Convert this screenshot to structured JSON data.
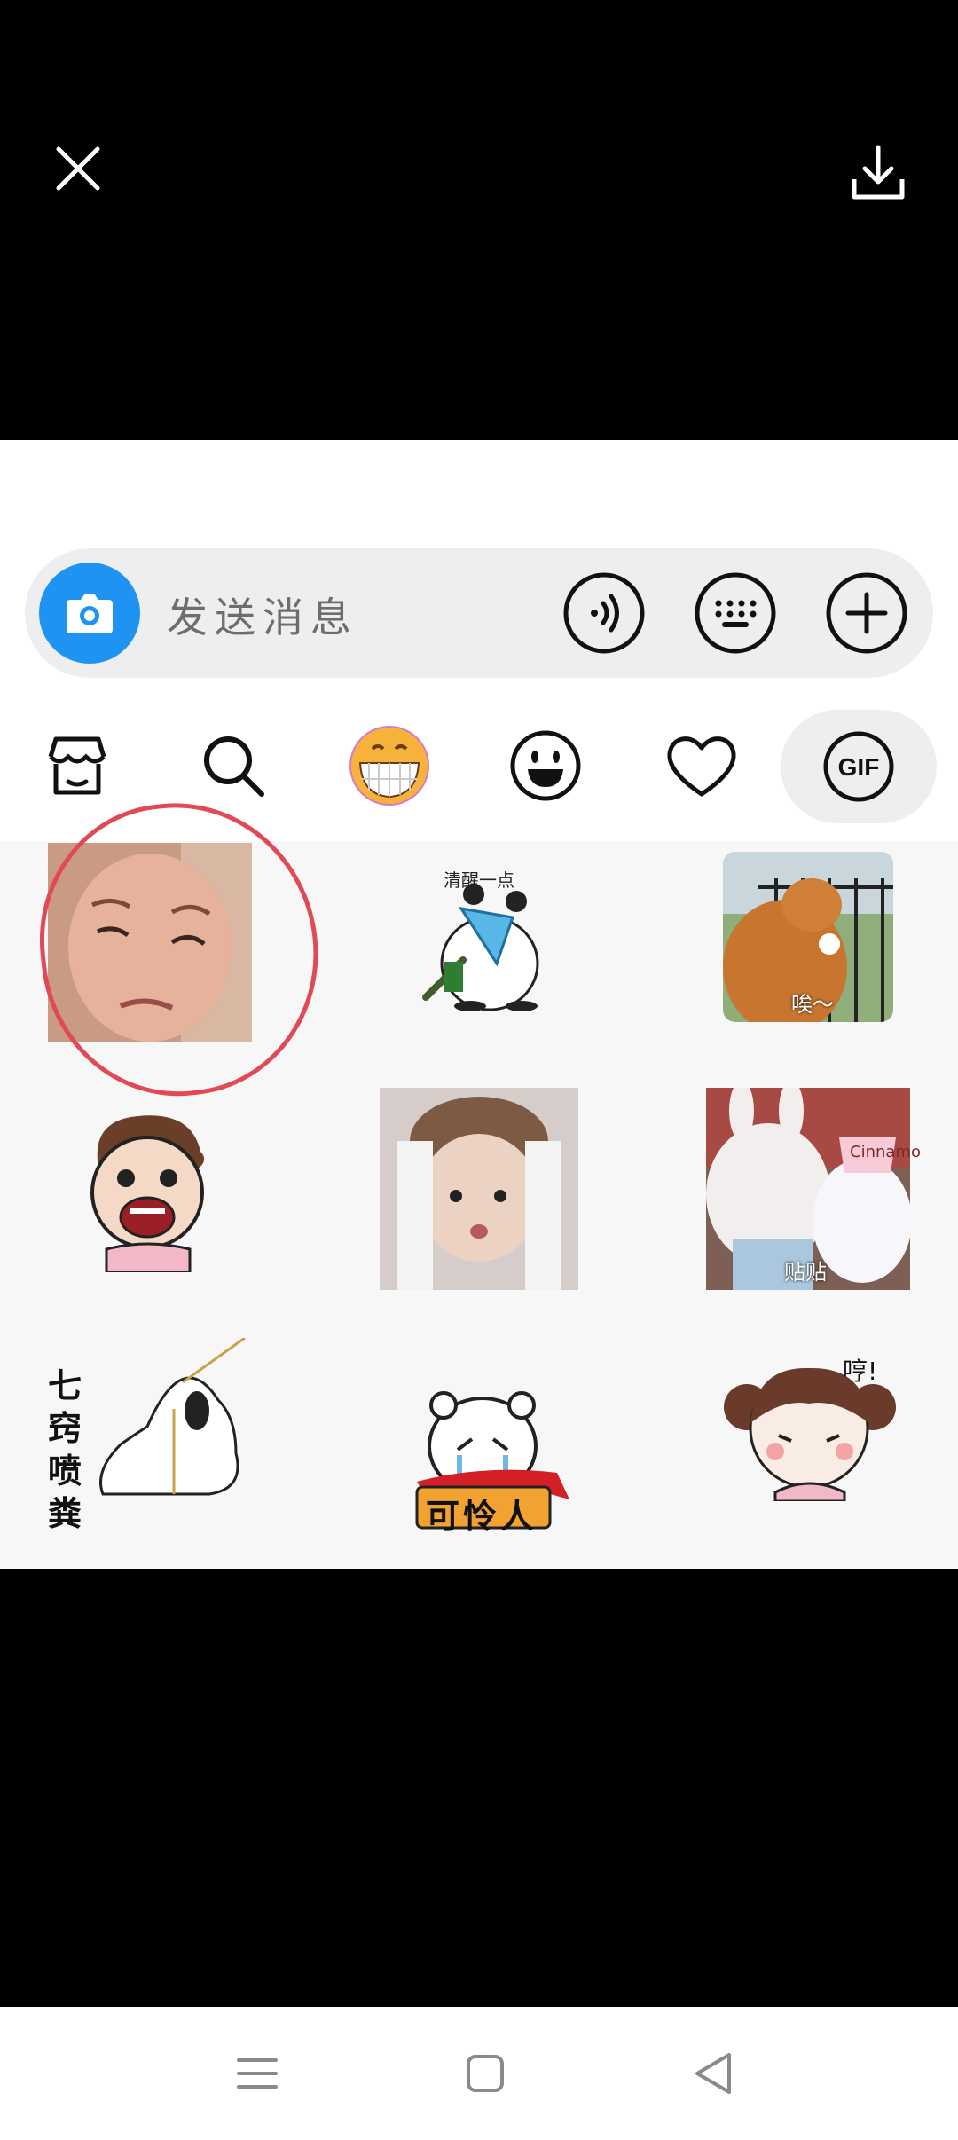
{
  "viewer": {
    "close_icon": "close-icon",
    "download_icon": "download-icon"
  },
  "composer": {
    "placeholder": "发送消息",
    "camera_icon": "camera-icon",
    "voice_icon": "voice-icon",
    "keyboard_icon": "keyboard-icon",
    "add_icon": "plus-icon",
    "camera_color": "#1f93f2"
  },
  "tabs": [
    {
      "name": "store",
      "icon": "store-icon"
    },
    {
      "name": "search",
      "icon": "search-icon"
    },
    {
      "name": "emoji-grin",
      "icon": "grin-emoji-icon"
    },
    {
      "name": "smiley",
      "icon": "smiley-icon"
    },
    {
      "name": "favorites",
      "icon": "heart-icon"
    },
    {
      "name": "gif",
      "icon": "gif-icon",
      "label": "GIF",
      "selected": true
    }
  ],
  "stickers": [
    {
      "id": "frowning-child",
      "caption": ""
    },
    {
      "id": "panda-spray",
      "caption": "清醒一点"
    },
    {
      "id": "cat-balcony",
      "caption": "唉～"
    },
    {
      "id": "cartoon-boy-crying",
      "caption": ""
    },
    {
      "id": "baby-holding-head",
      "caption": ""
    },
    {
      "id": "plush-rabbit-cinnamoroll",
      "caption": "贴贴",
      "extra": "Cinnamo"
    },
    {
      "id": "seven-holes",
      "caption": "七窍喷粪"
    },
    {
      "id": "crying-bear-banner",
      "caption": "可怜人"
    },
    {
      "id": "pigtail-girl",
      "caption": "哼!"
    }
  ],
  "annotation_color": "#e14a55",
  "system_nav": {
    "menu_icon": "menu-icon",
    "home_icon": "home-square-icon",
    "back_icon": "back-triangle-icon"
  }
}
